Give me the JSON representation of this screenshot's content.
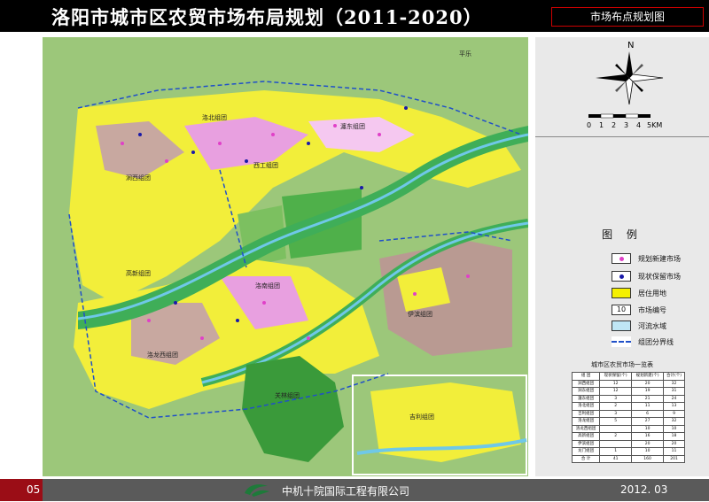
{
  "header": {
    "title": "洛阳市城市区农贸市场布局规划（2011-2020）",
    "sheet_label": "市场布点规划图"
  },
  "compass": {
    "north": "N",
    "scale_ticks": [
      "0",
      "1",
      "2",
      "3",
      "4",
      "5KM"
    ]
  },
  "map": {
    "labels": [
      "洛北组团",
      "瀍东组团",
      "涧西组团",
      "西工组团",
      "高新组团",
      "洛南组团",
      "伊滨组团",
      "洛龙西组团",
      "关林组团",
      "吉利组团",
      "平乐"
    ]
  },
  "legend": {
    "title": "图 例",
    "items": [
      {
        "label": "规划新建市场",
        "color": "#e040c8"
      },
      {
        "label": "现状保留市场",
        "color": "#1a1aa8"
      },
      {
        "label": "居住用地",
        "color": "#f5f000"
      },
      {
        "label": "市场编号",
        "value": "10"
      },
      {
        "label": "河流水域",
        "color": "#bfe6f5"
      },
      {
        "label": "组团分界线",
        "color": "#2050c8"
      }
    ]
  },
  "stats_table": {
    "title": "城市区农贸市场一览表",
    "headers": [
      "组 团",
      "现状保留(个)",
      "规划新建(个)",
      "合计(个)"
    ],
    "rows": [
      [
        "涧西组团",
        "12",
        "20",
        "32"
      ],
      [
        "涧东组团",
        "12",
        "19",
        "31"
      ],
      [
        "瀍东组团",
        "3",
        "21",
        "24"
      ],
      [
        "洛北组团",
        "2",
        "11",
        "13"
      ],
      [
        "吉利组团",
        "3",
        "6",
        "9"
      ],
      [
        "洛龙组团",
        "5",
        "27",
        "32"
      ],
      [
        "洛龙西组团",
        "",
        "10",
        "10"
      ],
      [
        "高新组团",
        "2",
        "16",
        "18"
      ],
      [
        "伊滨组团",
        "",
        "20",
        "20"
      ],
      [
        "龙门组团",
        "1",
        "10",
        "11"
      ],
      [
        "合 计",
        "41",
        "160",
        "201"
      ]
    ]
  },
  "footer": {
    "page": "05",
    "company": "中机十院国际工程有限公司",
    "date": "2012. 03"
  }
}
